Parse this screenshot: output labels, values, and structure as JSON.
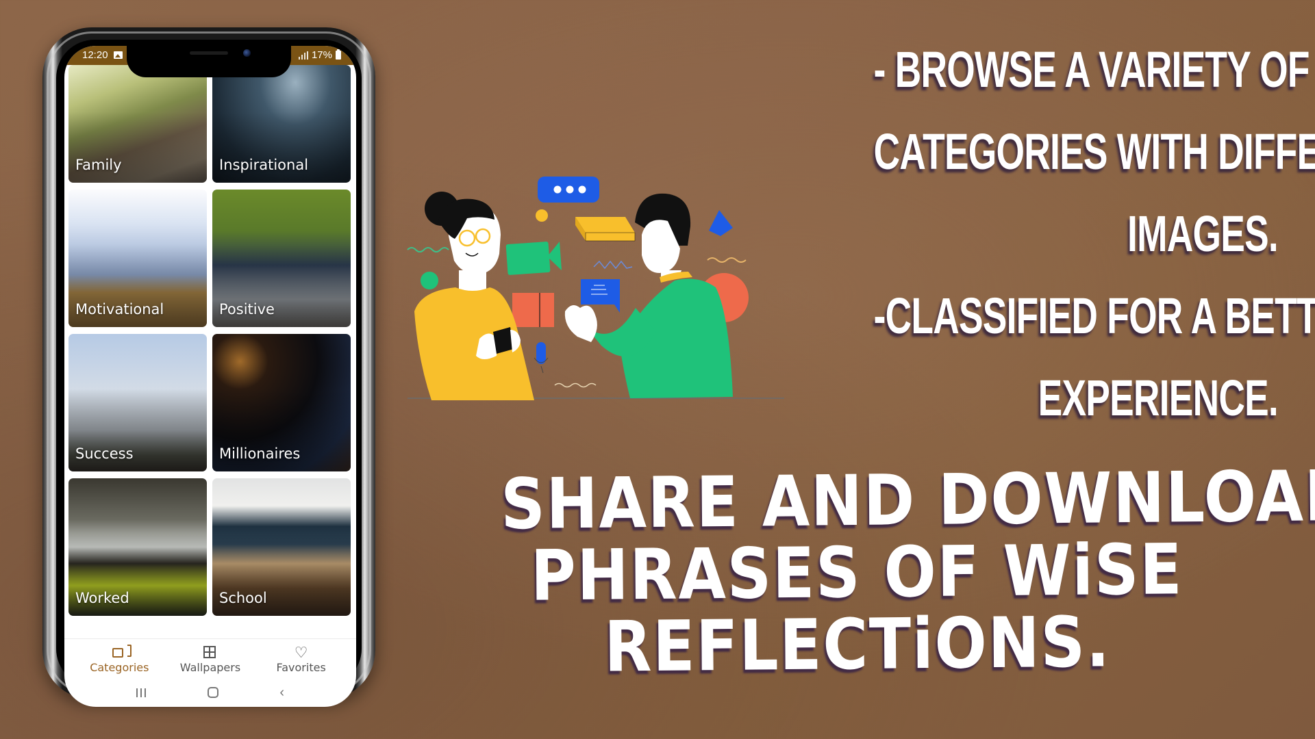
{
  "phone": {
    "statusbar": {
      "time": "12:20",
      "battery": "17%",
      "color": "#7a5314"
    },
    "categories": [
      {
        "label": "Family"
      },
      {
        "label": "Inspirational"
      },
      {
        "label": "Motivational"
      },
      {
        "label": "Positive"
      },
      {
        "label": "Success"
      },
      {
        "label": "Millionaires"
      },
      {
        "label": "Worked"
      },
      {
        "label": "School"
      }
    ],
    "bottom_nav": {
      "active_color": "#9a6424",
      "items": [
        {
          "label": "Categories",
          "icon": "categories-icon",
          "active": true
        },
        {
          "label": "Wallpapers",
          "icon": "grid-icon",
          "active": false
        },
        {
          "label": "Favorites",
          "icon": "heart-icon",
          "active": false
        }
      ]
    },
    "system_nav": {
      "recent": "recent-apps-icon",
      "home": "home-icon",
      "back": "back-icon",
      "back_glyph": "‹",
      "heart_glyph": "♡"
    }
  },
  "feature_text": {
    "lines": [
      "- BROWSE A VARIETY OF",
      "CATEGORIES WITH DIFFERENT",
      "IMAGES.",
      "-CLASSIFIED FOR A BETTER",
      "EXPERIENCE."
    ]
  },
  "headline": {
    "lines": [
      "SHARE AND DOWNLOAD",
      "PHRASES OF WiSE",
      "REFLECTiONS."
    ]
  },
  "illustration": {
    "description": "Two people chatting with floating communication icons",
    "colors": {
      "yellow": "#f8bf2c",
      "green": "#1fc27a",
      "red": "#ee6a4b",
      "blue": "#1e5ce6"
    }
  }
}
